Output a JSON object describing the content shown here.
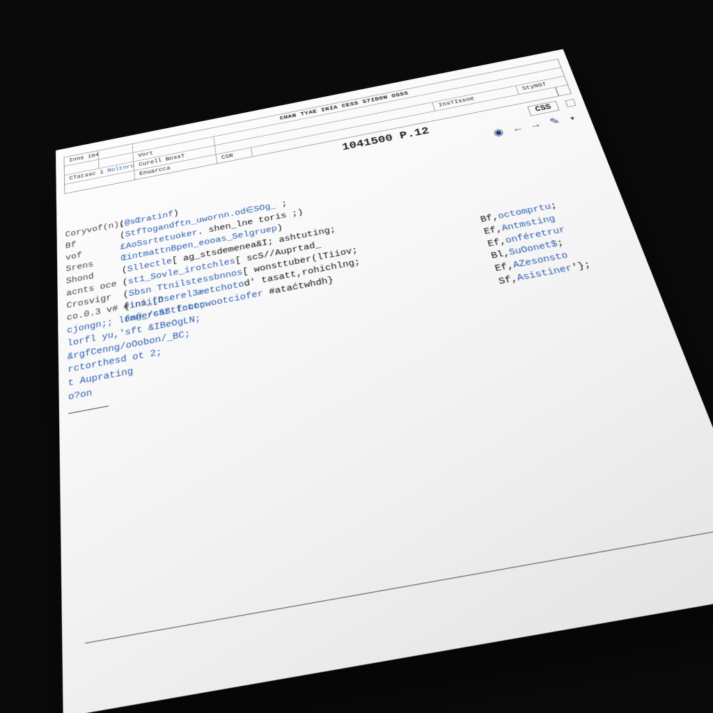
{
  "header": {
    "title": "CHAN TYAE INIA CESS S7IDON OSSS",
    "row1": {
      "c1": "Inns 104",
      "c2": "",
      "c3": "",
      "c4": ""
    },
    "row2": {
      "c1": "",
      "c2": "Vort",
      "c3": "",
      "c4": ""
    },
    "row3": {
      "c1": "CTatssc 1",
      "c2": "Moltnrusar",
      "c3": "Curell BossT",
      "c4": "",
      "c5": "InsTIssoe",
      "c6": "StyNGT"
    },
    "row4": {
      "c1": "",
      "c2": "",
      "c3": "Enuarcca",
      "c4": "CSR",
      "c5": "",
      "c6": ""
    }
  },
  "status": {
    "number": "1041500 P.12",
    "tag": "CSS"
  },
  "gutter": [
    "Coryvof(n);",
    "Bf",
    "vof",
    "Srens",
    "Shond",
    "acnts oce",
    "Crosvigr",
    "co.0.3 v# #ini_[D",
    "cjongn;; lonn_/cSS fnut;",
    "lorfl yu,'sft &IBeOgLN;",
    "&rgfCenng/oOobon/_BC;",
    "rctorthesd ot 2;",
    "t Auprating",
    "o?on"
  ],
  "code": [
    {
      "pre": "(",
      "kw": "@sŒratinf",
      "post": ")"
    },
    {
      "pre": "(",
      "kw": "StfTogandftn_uwornn.od∈SOg_",
      "post": " ;"
    },
    {
      "pre": "",
      "kw": "£AoSsrtetuoker",
      "post": ". shen_lne toris ;)"
    },
    {
      "pre": "",
      "kw": "ŒintmattnBpen_eooas_Selgruep",
      "post": ")"
    },
    {
      "pre": "(",
      "kw": "Sllectle",
      "post": "[ ag_stsdemenea&I; ashtuting;"
    },
    {
      "pre": "(",
      "kw": "st1_Sovle_irotchles",
      "post": "[ scS//Auprtad_"
    },
    {
      "pre": "(",
      "kw": "Sbsn Ttnilstessbnnos",
      "post": "[ wonsttuber(lTiiov;"
    },
    {
      "pre": "{",
      "kw": "innitnserel3æetchoto",
      "post": "d' tasatt,rohichlng;"
    },
    {
      "pre": "",
      "kw": "fm@ersartl:tonwootciofer",
      "post": " #ataćtwhdh}"
    }
  ],
  "side": [
    {
      "pre": "Bf,",
      "kw": "octomprtu",
      "post": ";"
    },
    {
      "pre": "Ef,",
      "kw": "Antmsting",
      "post": ""
    },
    {
      "pre": "Ef,",
      "kw": "onféretrur",
      "post": ""
    },
    {
      "pre": "Bl,",
      "kw": "SuOonet$",
      "post": ";"
    },
    {
      "pre": "Ef,",
      "kw": "AZesonsto",
      "post": ""
    },
    {
      "pre": "Sf,",
      "kw": "Asistiner",
      "post": "'};"
    }
  ]
}
